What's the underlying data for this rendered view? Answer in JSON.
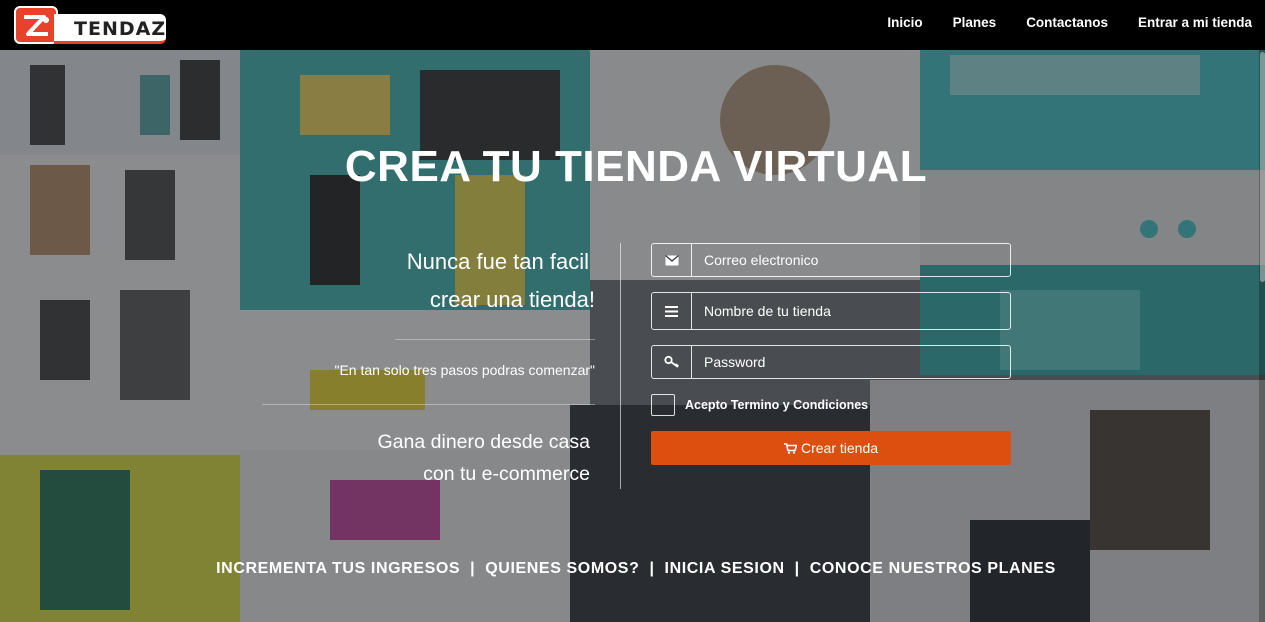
{
  "brand": {
    "logo_text": "TENDAZ",
    "accent": "#e8432a"
  },
  "nav": {
    "items": [
      {
        "label": "Inicio"
      },
      {
        "label": "Planes"
      },
      {
        "label": "Contactanos"
      },
      {
        "label": "Entrar a mi tienda"
      }
    ]
  },
  "hero": {
    "title": "CREA TU TIENDA VIRTUAL",
    "tagline_line1": "Nunca fue tan facil",
    "tagline_line2": "crear una tienda!",
    "quote": "\"En tan solo tres pasos podras comenzar\"",
    "tagline2_line1": "Gana dinero desde casa",
    "tagline2_line2": "con tu e-commerce"
  },
  "form": {
    "email_placeholder": "Correo electronico",
    "store_placeholder": "Nombre de tu tienda",
    "password_placeholder": "Password",
    "terms_label": "Acepto Termino y Condiciones",
    "submit_label": "Crear tienda",
    "submit_color": "#dc4f0f"
  },
  "footer_links": [
    {
      "label": "INCREMENTA TUS INGRESOS"
    },
    {
      "label": "QUIENES SOMOS?"
    },
    {
      "label": "INICIA SESION"
    },
    {
      "label": "CONOCE NUESTROS PLANES"
    }
  ],
  "separator": "|",
  "colors": {
    "navbar": "#000000",
    "overlay": "rgba(40,44,48,0.52)"
  }
}
